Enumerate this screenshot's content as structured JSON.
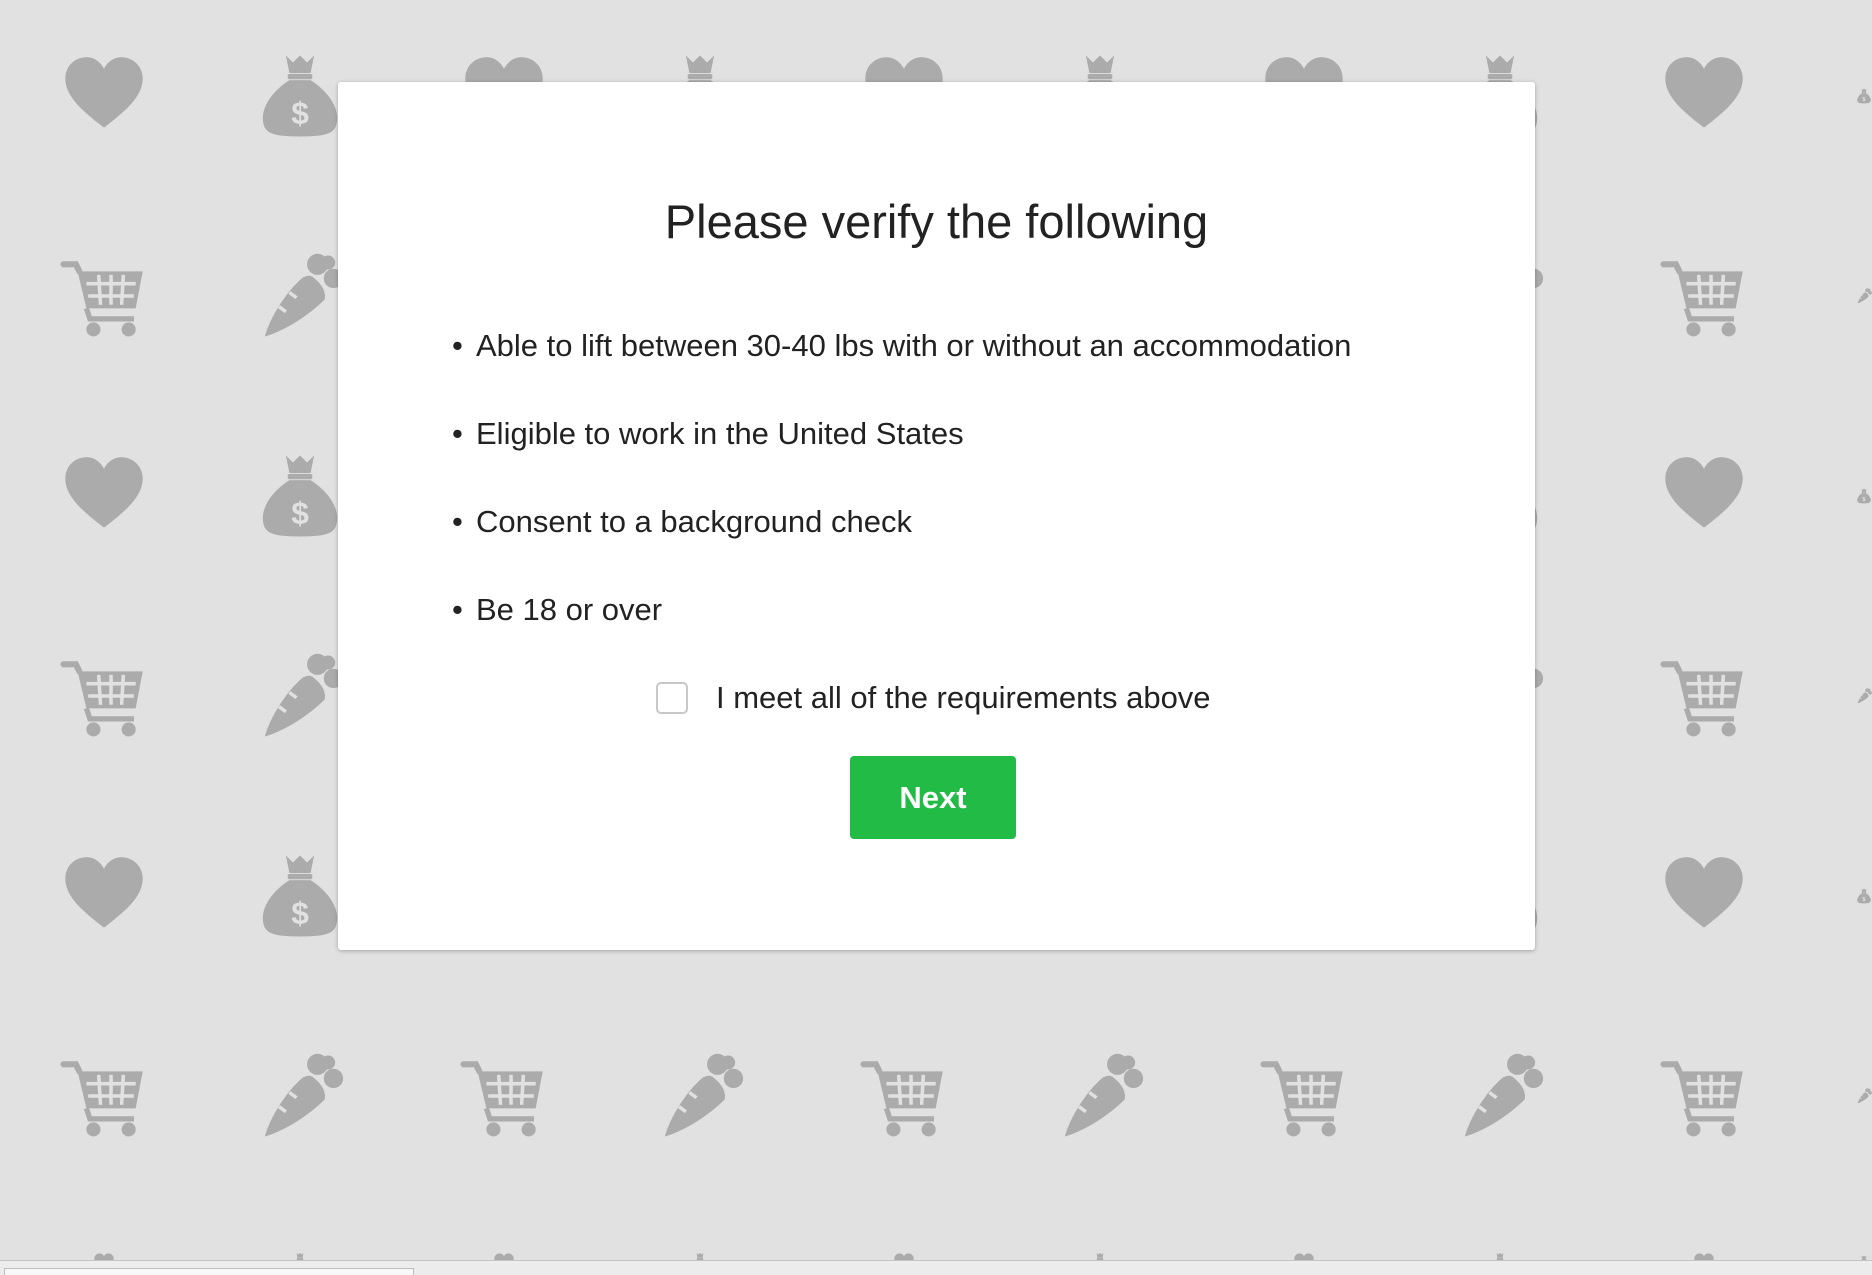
{
  "dialog": {
    "title": "Please verify the following",
    "requirements": [
      "Able to lift between 30-40 lbs with or without an accommodation",
      "Eligible to work in the United States",
      "Consent to a background check",
      "Be 18 or over"
    ],
    "bullet": "•",
    "confirm_label": "I meet all of the requirements above",
    "confirm_checked": false,
    "next_label": "Next"
  },
  "background": {
    "pattern_icons": [
      "heart-icon",
      "money-bag-icon",
      "shopping-cart-icon",
      "carrot-icon"
    ],
    "icon_color": "#ababab",
    "page_color": "#e1e1e1"
  },
  "colors": {
    "primary_button": "#22bb45",
    "text": "#222222",
    "modal": "#ffffff"
  }
}
